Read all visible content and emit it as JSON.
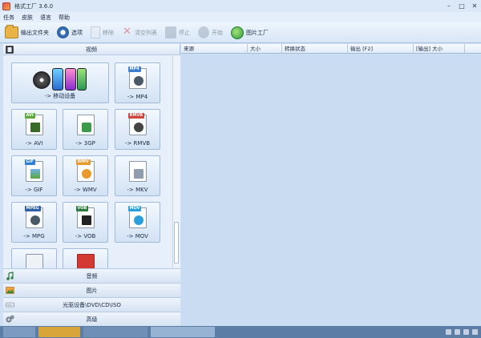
{
  "window": {
    "title": "格式工厂 3.6.0"
  },
  "menu": [
    "任务",
    "皮肤",
    "语言",
    "帮助"
  ],
  "toolbar": {
    "output_folder": "输出文件夹",
    "options": "选项",
    "remove": "移除",
    "clear_list": "清空列表",
    "stop": "停止",
    "start": "开始",
    "logo": "图片工厂"
  },
  "sidebar": {
    "video_section": "视频",
    "tiles": [
      {
        "label": "-> 移动设备",
        "icon": "mobile-devices-icon"
      },
      {
        "label": "-> MP4",
        "badge": "MP4",
        "color": "#3f7fd1"
      },
      {
        "label": "-> AVI",
        "badge": "AVI",
        "color": "#5aa83a"
      },
      {
        "label": "-> 3GP",
        "badge": "",
        "color": "#3d9a4b"
      },
      {
        "label": "-> RMVB",
        "badge": "RMVB",
        "color": "#d0453c"
      },
      {
        "label": "-> GIF",
        "badge": "GIF",
        "color": "#2b7fd6"
      },
      {
        "label": "-> WMV",
        "badge": "WMV",
        "color": "#e89a2c"
      },
      {
        "label": "-> MKV",
        "badge": "",
        "color": "#8e9eb0"
      },
      {
        "label": "-> MPG",
        "badge": "MPEG",
        "color": "#2f5fa8"
      },
      {
        "label": "-> VOB",
        "badge": "VOB",
        "color": "#2c7a3e"
      },
      {
        "label": "-> MOV",
        "badge": "MOV",
        "color": "#2a9fdc"
      }
    ],
    "collapsed": [
      {
        "label": "音频",
        "icon": "music-note-icon"
      },
      {
        "label": "图片",
        "icon": "picture-icon"
      },
      {
        "label": "光驱设备\\DVD\\CD\\ISO",
        "icon": "disc-drive-icon"
      },
      {
        "label": "高级",
        "icon": "gears-icon"
      }
    ]
  },
  "grid": {
    "columns": [
      "来源",
      "大小",
      "转换状态",
      "输出 [F2]",
      "[输出] 大小"
    ]
  },
  "colors": {
    "accent": "#3e79c2",
    "panel": "#c9dcf2"
  }
}
